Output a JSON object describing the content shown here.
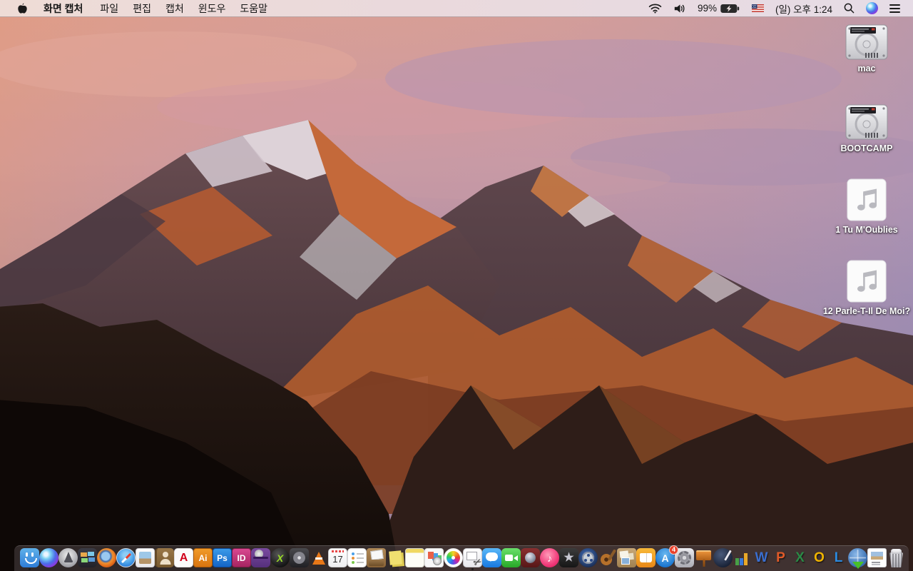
{
  "menu_bar": {
    "app_name": "화면 캡처",
    "menus": [
      "파일",
      "편집",
      "캡처",
      "윈도우",
      "도움말"
    ],
    "status": {
      "battery_percent": "99%",
      "clock": "(일) 오후 1:24"
    }
  },
  "desktop": {
    "icons": [
      {
        "id": "mac",
        "label": "mac",
        "kind": "hard-drive"
      },
      {
        "id": "bootcamp",
        "label": "BOOTCAMP",
        "kind": "hard-drive"
      },
      {
        "id": "song1",
        "label": "1 Tu M'Oublies",
        "kind": "audio-file"
      },
      {
        "id": "song2",
        "label": "12 Parle-T-Il De Moi?",
        "kind": "audio-file"
      }
    ]
  },
  "dock": {
    "items": [
      {
        "id": "finder",
        "running": true
      },
      {
        "id": "siri"
      },
      {
        "id": "launchpad"
      },
      {
        "id": "mission-control"
      },
      {
        "id": "firefox"
      },
      {
        "id": "safari"
      },
      {
        "id": "preview"
      },
      {
        "id": "contacts"
      },
      {
        "id": "acrobat",
        "glyph": "A"
      },
      {
        "id": "illustrator",
        "glyph": "Ai"
      },
      {
        "id": "photoshop",
        "glyph": "Ps"
      },
      {
        "id": "indesign",
        "glyph": "ID"
      },
      {
        "id": "toast"
      },
      {
        "id": "green-x",
        "glyph": "X"
      },
      {
        "id": "disk-tool"
      },
      {
        "id": "vlc"
      },
      {
        "id": "calendar",
        "glyph": "17"
      },
      {
        "id": "reminders"
      },
      {
        "id": "mail-box"
      },
      {
        "id": "stickies"
      },
      {
        "id": "notes"
      },
      {
        "id": "cards"
      },
      {
        "id": "photos"
      },
      {
        "id": "grab",
        "glyph": "✂",
        "running": true
      },
      {
        "id": "messages"
      },
      {
        "id": "facetime"
      },
      {
        "id": "photo-booth"
      },
      {
        "id": "itunes",
        "glyph": "♪"
      },
      {
        "id": "imovie",
        "glyph": "★"
      },
      {
        "id": "film-reel"
      },
      {
        "id": "garageband"
      },
      {
        "id": "collage"
      },
      {
        "id": "ibooks"
      },
      {
        "id": "app-store",
        "glyph": "A",
        "badge": "4"
      },
      {
        "id": "system-preferences"
      },
      {
        "id": "keynote"
      },
      {
        "id": "pages"
      },
      {
        "id": "numbers"
      },
      {
        "id": "word",
        "glyph": "W"
      },
      {
        "id": "powerpoint",
        "glyph": "P"
      },
      {
        "id": "excel",
        "glyph": "X"
      },
      {
        "id": "outlook",
        "glyph": "O"
      },
      {
        "id": "lync",
        "glyph": "L"
      },
      {
        "id": "globe-download"
      },
      {
        "id": "divider",
        "divider": true
      },
      {
        "id": "document-file"
      },
      {
        "id": "trash"
      }
    ]
  }
}
